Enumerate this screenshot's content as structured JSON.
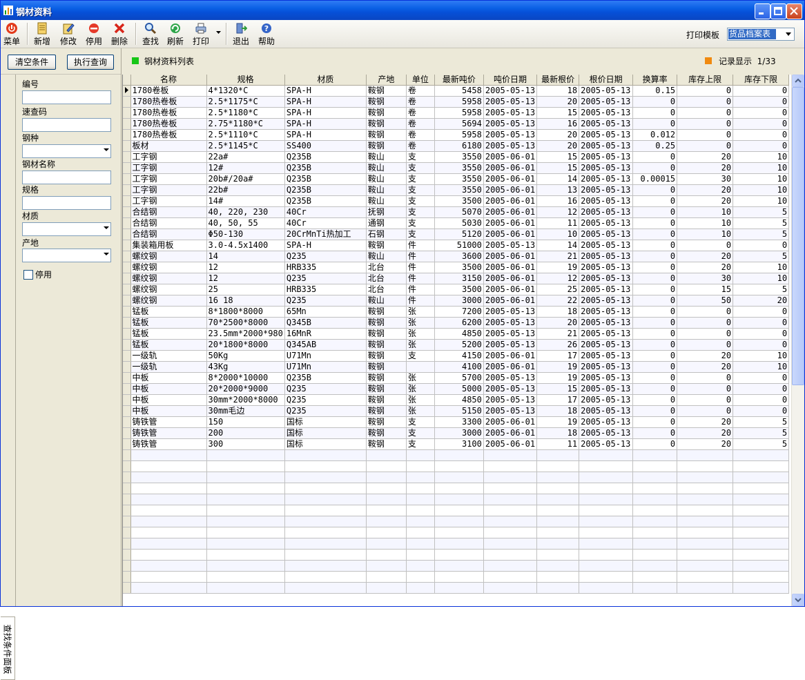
{
  "window": {
    "title": "钢材资料"
  },
  "toolbar": {
    "menu": "菜单",
    "add": "新增",
    "edit": "修改",
    "disable": "停用",
    "delete": "删除",
    "find": "查找",
    "refresh": "刷新",
    "print": "打印",
    "exit": "退出",
    "help": "帮助",
    "print_template_label": "打印模板",
    "print_template_value": "货品档案表"
  },
  "conditions": {
    "clear_label": "清空条件",
    "query_label": "执行查询",
    "code_label": "编号",
    "code_value": "",
    "quick_label": "速查码",
    "quick_value": "",
    "kind_label": "钢种",
    "kind_value": "",
    "name_label": "钢材名称",
    "name_value": "",
    "spec_label": "规格",
    "spec_value": "",
    "material_label": "材质",
    "material_value": "",
    "origin_label": "产地",
    "origin_value": "",
    "disabled_label": "停用",
    "side_tab": "查找条件面板"
  },
  "list": {
    "title": "钢材资料列表",
    "record_label": "记录显示",
    "record_value": "1/33"
  },
  "columns": [
    "名称",
    "规格",
    "材质",
    "产地",
    "单位",
    "最新吨价",
    "吨价日期",
    "最新根价",
    "根价日期",
    "换算率",
    "库存上限",
    "库存下限"
  ],
  "rows": [
    [
      "1780卷板",
      "4*1320*C",
      "SPA-H",
      "鞍钢",
      "卷",
      "5458",
      "2005-05-13",
      "18",
      "2005-05-13",
      "0.15",
      "0",
      "0"
    ],
    [
      "1780热卷板",
      "2.5*1175*C",
      "SPA-H",
      "鞍钢",
      "卷",
      "5958",
      "2005-05-13",
      "20",
      "2005-05-13",
      "0",
      "0",
      "0"
    ],
    [
      "1780热卷板",
      "2.5*1180*C",
      "SPA-H",
      "鞍钢",
      "卷",
      "5958",
      "2005-05-13",
      "15",
      "2005-05-13",
      "0",
      "0",
      "0"
    ],
    [
      "1780热卷板",
      "2.75*1180*C",
      "SPA-H",
      "鞍钢",
      "卷",
      "5694",
      "2005-05-13",
      "16",
      "2005-05-13",
      "0",
      "0",
      "0"
    ],
    [
      "1780热卷板",
      "2.5*1110*C",
      "SPA-H",
      "鞍钢",
      "卷",
      "5958",
      "2005-05-13",
      "20",
      "2005-05-13",
      "0.012",
      "0",
      "0"
    ],
    [
      "板材",
      "2.5*1145*C",
      "SS400",
      "鞍钢",
      "卷",
      "6180",
      "2005-05-13",
      "20",
      "2005-05-13",
      "0.25",
      "0",
      "0"
    ],
    [
      "工字钢",
      "22a#",
      "Q235B",
      "鞍山",
      "支",
      "3550",
      "2005-06-01",
      "15",
      "2005-05-13",
      "0",
      "20",
      "10"
    ],
    [
      "工字钢",
      "12#",
      "Q235B",
      "鞍山",
      "支",
      "3550",
      "2005-06-01",
      "15",
      "2005-05-13",
      "0",
      "20",
      "10"
    ],
    [
      "工字钢",
      "20b#/20a#",
      "Q235B",
      "鞍山",
      "支",
      "3550",
      "2005-06-01",
      "14",
      "2005-05-13",
      "0.00015",
      "30",
      "10"
    ],
    [
      "工字钢",
      "22b#",
      "Q235B",
      "鞍山",
      "支",
      "3550",
      "2005-06-01",
      "13",
      "2005-05-13",
      "0",
      "20",
      "10"
    ],
    [
      "工字钢",
      "14#",
      "Q235B",
      "鞍山",
      "支",
      "3500",
      "2005-06-01",
      "16",
      "2005-05-13",
      "0",
      "20",
      "10"
    ],
    [
      "合结钢",
      "40, 220, 230",
      "40Cr",
      "抚钢",
      "支",
      "5070",
      "2005-06-01",
      "12",
      "2005-05-13",
      "0",
      "10",
      "5"
    ],
    [
      "合结钢",
      "40, 50, 55",
      "40Cr",
      "通钢",
      "支",
      "5030",
      "2005-06-01",
      "11",
      "2005-05-13",
      "0",
      "10",
      "5"
    ],
    [
      "合结钢",
      "Φ50-130",
      "20CrMnTi热加工",
      "石钢",
      "支",
      "5120",
      "2005-06-01",
      "10",
      "2005-05-13",
      "0",
      "10",
      "5"
    ],
    [
      "集装箱用板",
      "3.0-4.5x1400",
      "SPA-H",
      "鞍钢",
      "件",
      "51000",
      "2005-05-13",
      "14",
      "2005-05-13",
      "0",
      "0",
      "0"
    ],
    [
      "螺纹钢",
      "14",
      "Q235",
      "鞍山",
      "件",
      "3600",
      "2005-06-01",
      "21",
      "2005-05-13",
      "0",
      "20",
      "5"
    ],
    [
      "螺纹钢",
      "12",
      "HRB335",
      "北台",
      "件",
      "3500",
      "2005-06-01",
      "19",
      "2005-05-13",
      "0",
      "20",
      "10"
    ],
    [
      "螺纹钢",
      "12",
      "Q235",
      "北台",
      "件",
      "3150",
      "2005-06-01",
      "12",
      "2005-05-13",
      "0",
      "30",
      "10"
    ],
    [
      "螺纹钢",
      "25",
      "HRB335",
      "北台",
      "件",
      "3500",
      "2005-06-01",
      "25",
      "2005-05-13",
      "0",
      "15",
      "5"
    ],
    [
      "螺纹钢",
      "16 18",
      "Q235",
      "鞍山",
      "件",
      "3000",
      "2005-06-01",
      "22",
      "2005-05-13",
      "0",
      "50",
      "20"
    ],
    [
      "锰板",
      "8*1800*8000",
      "65Mn",
      "鞍钢",
      "张",
      "7200",
      "2005-05-13",
      "18",
      "2005-05-13",
      "0",
      "0",
      "0"
    ],
    [
      "锰板",
      "70*2500*8000",
      "Q345B",
      "鞍钢",
      "张",
      "6200",
      "2005-05-13",
      "20",
      "2005-05-13",
      "0",
      "0",
      "0"
    ],
    [
      "锰板",
      "23.5mm*2000*980",
      "16MnR",
      "鞍钢",
      "张",
      "4850",
      "2005-05-13",
      "21",
      "2005-05-13",
      "0",
      "0",
      "0"
    ],
    [
      "锰板",
      "20*1800*8000",
      "Q345AB",
      "鞍钢",
      "张",
      "5200",
      "2005-05-13",
      "26",
      "2005-05-13",
      "0",
      "0",
      "0"
    ],
    [
      "一级轨",
      "50Kg",
      "U71Mn",
      "鞍钢",
      "支",
      "4150",
      "2005-06-01",
      "17",
      "2005-05-13",
      "0",
      "20",
      "10"
    ],
    [
      "一级轨",
      "43Kg",
      "U71Mn",
      "鞍钢",
      "",
      "4100",
      "2005-06-01",
      "19",
      "2005-05-13",
      "0",
      "20",
      "10"
    ],
    [
      "中板",
      "8*2000*10000",
      "Q235B",
      "鞍钢",
      "张",
      "5700",
      "2005-05-13",
      "19",
      "2005-05-13",
      "0",
      "0",
      "0"
    ],
    [
      "中板",
      "20*2000*9000",
      "Q235",
      "鞍钢",
      "张",
      "5000",
      "2005-05-13",
      "15",
      "2005-05-13",
      "0",
      "0",
      "0"
    ],
    [
      "中板",
      "30mm*2000*8000",
      "Q235",
      "鞍钢",
      "张",
      "4850",
      "2005-05-13",
      "17",
      "2005-05-13",
      "0",
      "0",
      "0"
    ],
    [
      "中板",
      "30mm毛边",
      "Q235",
      "鞍钢",
      "张",
      "5150",
      "2005-05-13",
      "18",
      "2005-05-13",
      "0",
      "0",
      "0"
    ],
    [
      "铸铁管",
      "150",
      "国标",
      "鞍钢",
      "支",
      "3300",
      "2005-06-01",
      "19",
      "2005-05-13",
      "0",
      "20",
      "5"
    ],
    [
      "铸铁管",
      "200",
      "国标",
      "鞍钢",
      "支",
      "3000",
      "2005-06-01",
      "18",
      "2005-05-13",
      "0",
      "20",
      "5"
    ],
    [
      "铸铁管",
      "300",
      "国标",
      "鞍钢",
      "支",
      "3100",
      "2005-06-01",
      "11",
      "2005-05-13",
      "0",
      "20",
      "5"
    ]
  ],
  "colors": {
    "title_bar": "#0a5fe4",
    "selection": "#316ac5",
    "green_marker": "#17c617",
    "orange_marker": "#f08a10"
  }
}
